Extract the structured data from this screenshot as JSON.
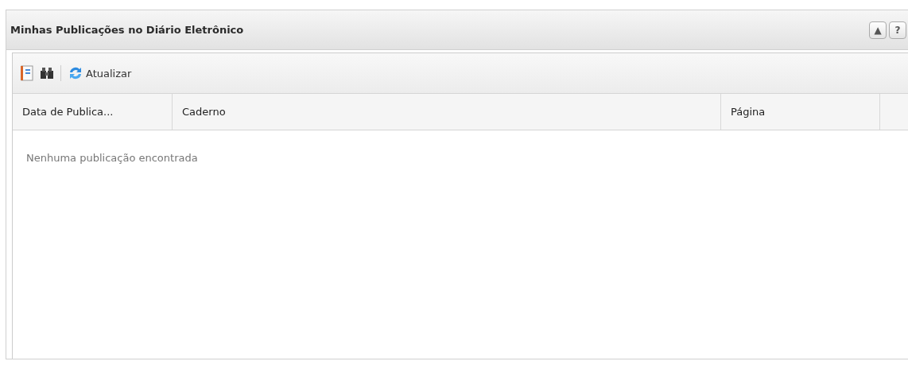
{
  "panel": {
    "title": "Minhas Publicações no Diário Eletrônico",
    "tools": [
      "▲",
      "?"
    ]
  },
  "toolbar": {
    "refresh_label": "Atualizar"
  },
  "table": {
    "columns": [
      "Data de Publica...",
      "Caderno",
      "Página"
    ],
    "empty_message": "Nenhuma publicação encontrada"
  }
}
